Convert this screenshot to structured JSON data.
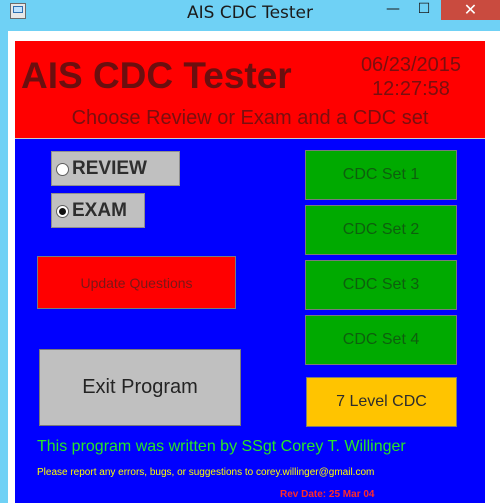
{
  "window": {
    "title": "AIS CDC Tester",
    "controls": {
      "minimize": "—",
      "maximize": "☐",
      "close": "✕"
    }
  },
  "header": {
    "app_title": "AIS CDC Tester",
    "date": "06/23/2015",
    "time": "12:27:58",
    "instruction": "Choose Review or Exam and a CDC set"
  },
  "mode": {
    "options": [
      {
        "label": "REVIEW",
        "selected": false
      },
      {
        "label": "EXAM",
        "selected": true
      }
    ]
  },
  "actions": {
    "update_questions": "Update Questions",
    "exit_program": "Exit Program"
  },
  "cdc_sets": [
    "CDC Set 1",
    "CDC Set 2",
    "CDC Set 3",
    "CDC Set 4"
  ],
  "seven_level": "7 Level CDC",
  "footer": {
    "author": "This program was written by SSgt Corey T. Willinger",
    "report": "Please report any errors, bugs, or suggestions to corey.willinger@gmail.com",
    "revision": "Rev Date: 25 Mar 04"
  },
  "colors": {
    "header_bg": "#ff0000",
    "main_bg": "#0000ff",
    "cdc_button_bg": "#00aa00",
    "seven_level_bg": "#ffc400",
    "exit_button_bg": "#c0c0c0",
    "author_text": "#28e428",
    "report_text": "#ffff00",
    "revision_text": "#ff2b2b"
  },
  "icons": {
    "app": "application-window-icon",
    "radio_unchecked": "radio-unchecked-icon",
    "radio_checked": "radio-checked-icon"
  }
}
